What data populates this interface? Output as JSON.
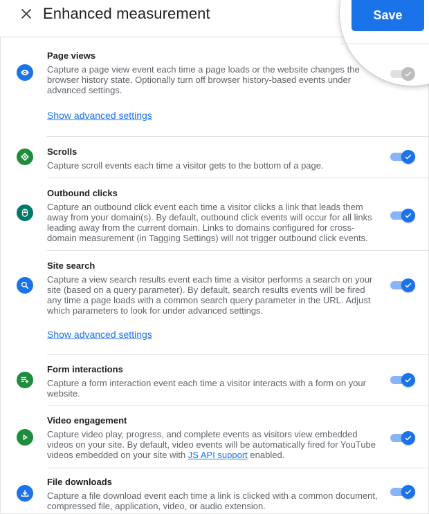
{
  "header": {
    "title": "Enhanced measurement",
    "save_label": "Save",
    "close_icon": "close-icon"
  },
  "colors": {
    "accent": "#1a73e8",
    "toggle_track": "#8ab4f8",
    "green_icon": "#1e8e3e",
    "teal_icon": "#00796b",
    "blue_icon": "#1a73e8"
  },
  "items": [
    {
      "name": "Page views",
      "icon": "eye-icon",
      "desc": "Capture a page view event each time a page loads or the website changes the browser history state. Optionally turn off browser history-based events under advanced settings.",
      "advanced_link": "Show advanced settings",
      "enabled": true,
      "toggle_disabled": true
    },
    {
      "name": "Scrolls",
      "icon": "scroll-icon",
      "desc": "Capture scroll events each time a visitor gets to the bottom of a page.",
      "enabled": true
    },
    {
      "name": "Outbound clicks",
      "icon": "mouse-icon",
      "desc": "Capture an outbound click event each time a visitor clicks a link that leads them away from your domain(s). By default, outbound click events will occur for all links leading away from the current domain. Links to domains configured for cross-domain measurement (in Tagging Settings) will not trigger outbound click events.",
      "enabled": true
    },
    {
      "name": "Site search",
      "icon": "search-icon",
      "desc": "Capture a view search results event each time a visitor performs a search on your site (based on a query parameter). By default, search results events will be fired any time a page loads with a common search query parameter in the URL. Adjust which parameters to look for under advanced settings.",
      "advanced_link": "Show advanced settings",
      "enabled": true
    },
    {
      "name": "Form interactions",
      "icon": "form-icon",
      "desc": "Capture a form interaction event each time a visitor interacts with a form on your website.",
      "enabled": true
    },
    {
      "name": "Video engagement",
      "icon": "play-icon",
      "desc_before": "Capture video play, progress, and complete events as visitors view embedded videos on your site. By default, video events will be automatically fired for YouTube videos embedded on your site with ",
      "desc_link": "JS API support",
      "desc_after": " enabled.",
      "enabled": true
    },
    {
      "name": "File downloads",
      "icon": "download-icon",
      "desc": "Capture a file download event each time a link is clicked with a common document, compressed file, application, video, or audio extension.",
      "enabled": true
    }
  ]
}
